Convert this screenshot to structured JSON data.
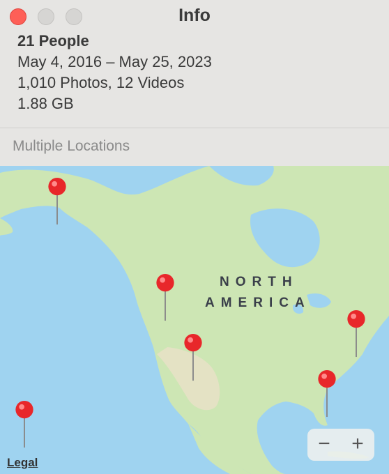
{
  "window": {
    "title": "Info"
  },
  "info": {
    "people": "21 People",
    "date_range": "May 4, 2016 – May 25, 2023",
    "counts": "1,010 Photos, 12 Videos",
    "size": "1.88 GB"
  },
  "locations_label": "Multiple Locations",
  "map": {
    "continent_label_line1": "NORTH",
    "continent_label_line2": "AMERICA",
    "legal_label": "Legal",
    "zoom_out_label": "−",
    "zoom_in_label": "+",
    "pin_color": "#e8272a",
    "ocean_color": "#9fd3f0",
    "land_color": "#cde6b4"
  }
}
